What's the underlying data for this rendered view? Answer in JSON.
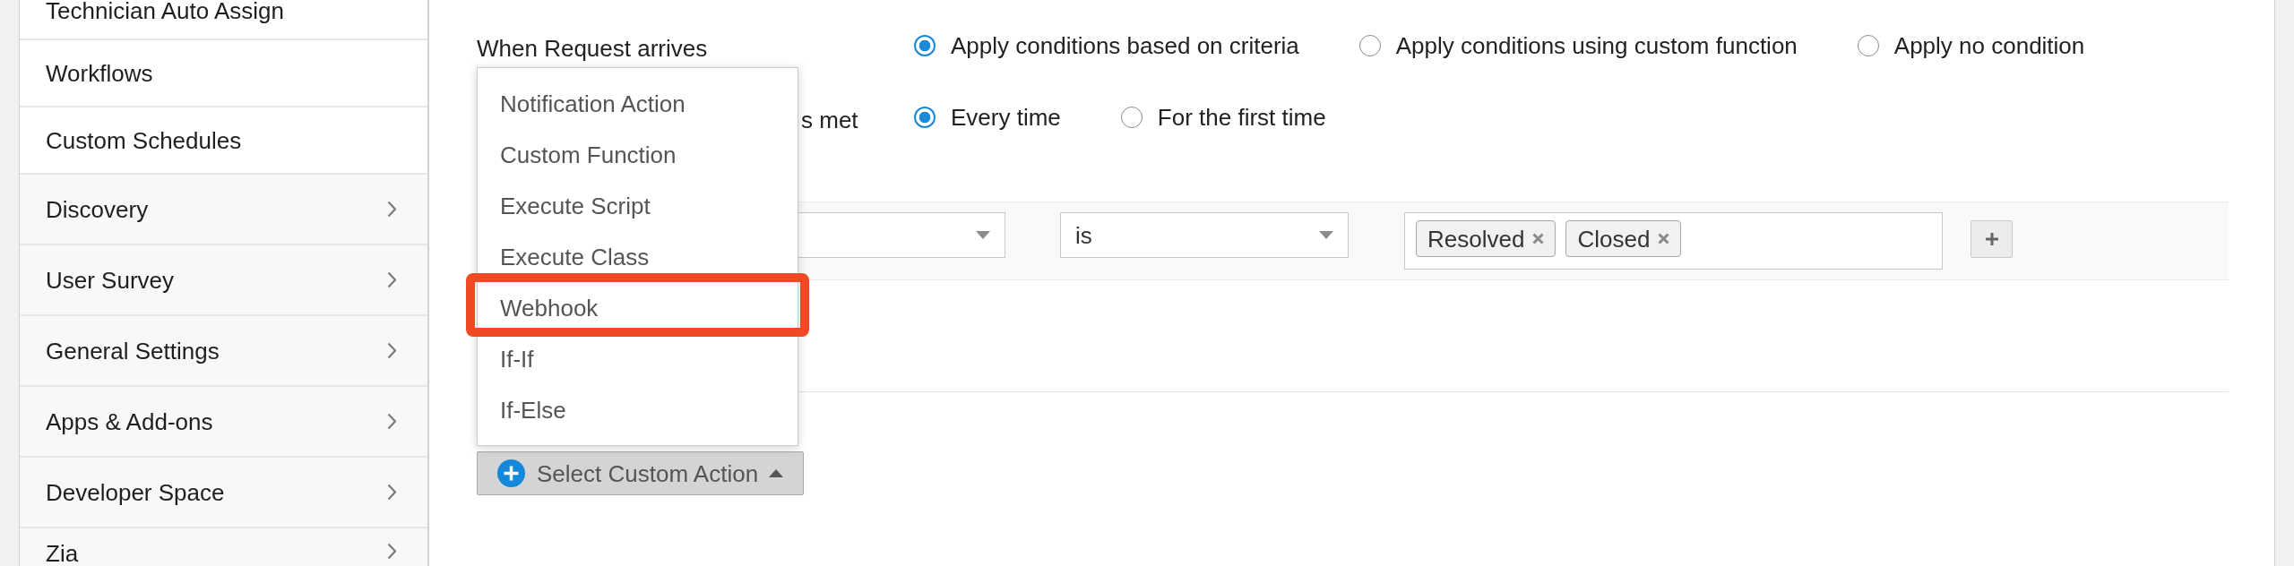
{
  "sidebar": {
    "items": [
      {
        "label": "Technician Auto Assign",
        "kind": "link"
      },
      {
        "label": "Workflows",
        "kind": "link"
      },
      {
        "label": "Custom Schedules",
        "kind": "link"
      },
      {
        "label": "Discovery",
        "kind": "group"
      },
      {
        "label": "User Survey",
        "kind": "group"
      },
      {
        "label": "General Settings",
        "kind": "group"
      },
      {
        "label": "Apps & Add-ons",
        "kind": "group"
      },
      {
        "label": "Developer Space",
        "kind": "group"
      },
      {
        "label": "Zia",
        "kind": "group"
      }
    ]
  },
  "trigger": {
    "label": "When Request arrives",
    "options": [
      {
        "label": "Apply conditions based on criteria",
        "selected": true
      },
      {
        "label": "Apply conditions using custom function",
        "selected": false
      },
      {
        "label": "Apply no condition",
        "selected": false
      }
    ]
  },
  "frequency": {
    "label": "s met",
    "options": [
      {
        "label": "Every time",
        "selected": true
      },
      {
        "label": "For the first time",
        "selected": false
      }
    ]
  },
  "criteria": {
    "operator": "is",
    "values": [
      "Resolved",
      "Closed"
    ]
  },
  "custom_action": {
    "label": "Select Custom Action",
    "open": true,
    "menu": [
      {
        "label": "Notification Action",
        "highlighted": false
      },
      {
        "label": "Custom Function",
        "highlighted": false
      },
      {
        "label": "Execute Script",
        "highlighted": false
      },
      {
        "label": "Execute Class",
        "highlighted": false
      },
      {
        "label": "Webhook",
        "highlighted": true
      },
      {
        "label": "If-If",
        "highlighted": false
      },
      {
        "label": "If-Else",
        "highlighted": false
      }
    ]
  }
}
